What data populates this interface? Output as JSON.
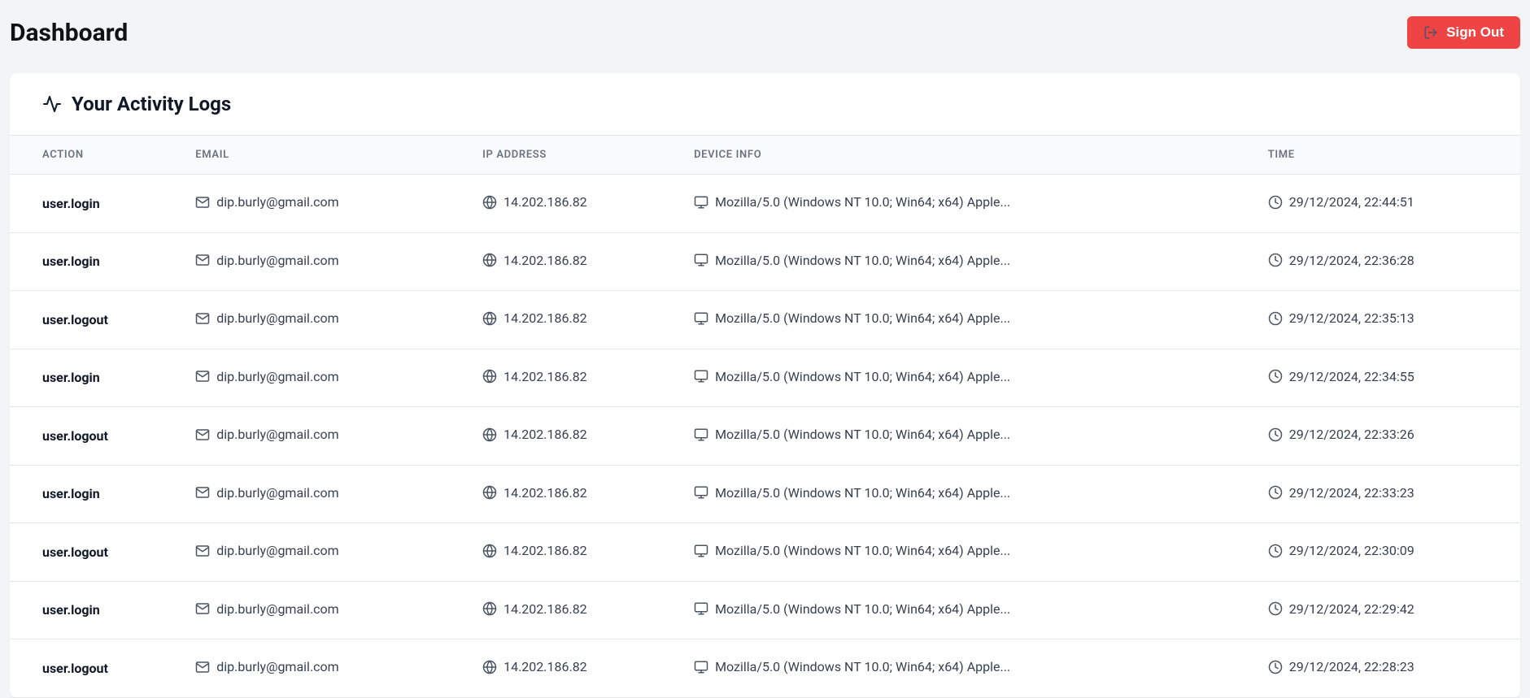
{
  "header": {
    "title": "Dashboard",
    "signout_label": "Sign Out"
  },
  "card": {
    "title": "Your Activity Logs"
  },
  "columns": {
    "action": "ACTION",
    "email": "EMAIL",
    "ip": "IP ADDRESS",
    "device": "DEVICE INFO",
    "time": "TIME"
  },
  "logs": [
    {
      "action": "user.login",
      "email": "dip.burly@gmail.com",
      "ip": "14.202.186.82",
      "device": "Mozilla/5.0 (Windows NT 10.0; Win64; x64) Apple...",
      "time": "29/12/2024, 22:44:51"
    },
    {
      "action": "user.login",
      "email": "dip.burly@gmail.com",
      "ip": "14.202.186.82",
      "device": "Mozilla/5.0 (Windows NT 10.0; Win64; x64) Apple...",
      "time": "29/12/2024, 22:36:28"
    },
    {
      "action": "user.logout",
      "email": "dip.burly@gmail.com",
      "ip": "14.202.186.82",
      "device": "Mozilla/5.0 (Windows NT 10.0; Win64; x64) Apple...",
      "time": "29/12/2024, 22:35:13"
    },
    {
      "action": "user.login",
      "email": "dip.burly@gmail.com",
      "ip": "14.202.186.82",
      "device": "Mozilla/5.0 (Windows NT 10.0; Win64; x64) Apple...",
      "time": "29/12/2024, 22:34:55"
    },
    {
      "action": "user.logout",
      "email": "dip.burly@gmail.com",
      "ip": "14.202.186.82",
      "device": "Mozilla/5.0 (Windows NT 10.0; Win64; x64) Apple...",
      "time": "29/12/2024, 22:33:26"
    },
    {
      "action": "user.login",
      "email": "dip.burly@gmail.com",
      "ip": "14.202.186.82",
      "device": "Mozilla/5.0 (Windows NT 10.0; Win64; x64) Apple...",
      "time": "29/12/2024, 22:33:23"
    },
    {
      "action": "user.logout",
      "email": "dip.burly@gmail.com",
      "ip": "14.202.186.82",
      "device": "Mozilla/5.0 (Windows NT 10.0; Win64; x64) Apple...",
      "time": "29/12/2024, 22:30:09"
    },
    {
      "action": "user.login",
      "email": "dip.burly@gmail.com",
      "ip": "14.202.186.82",
      "device": "Mozilla/5.0 (Windows NT 10.0; Win64; x64) Apple...",
      "time": "29/12/2024, 22:29:42"
    },
    {
      "action": "user.logout",
      "email": "dip.burly@gmail.com",
      "ip": "14.202.186.82",
      "device": "Mozilla/5.0 (Windows NT 10.0; Win64; x64) Apple...",
      "time": "29/12/2024, 22:28:23"
    }
  ]
}
